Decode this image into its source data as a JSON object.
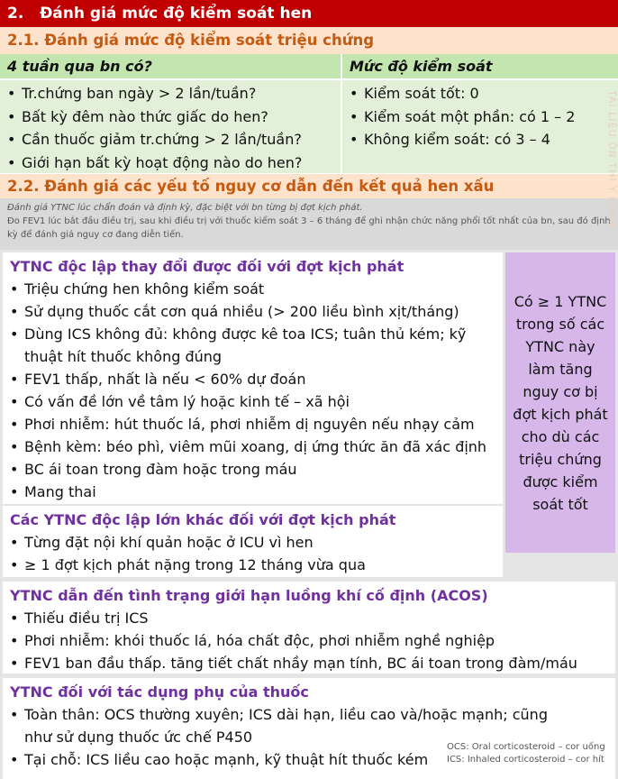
{
  "section": {
    "number": "2.",
    "title": "Đánh giá mức độ kiểm soát hen"
  },
  "symptom_control": {
    "heading": "2.1.  Đánh giá mức độ kiểm soát triệu chứng",
    "question_header": "4 tuần qua bn có?",
    "level_header": "Mức độ kiểm soát",
    "questions": [
      "Tr.chứng ban ngày > 2 lần/tuần?",
      "Bất kỳ đêm nào thức giấc do hen?",
      "Cần thuốc giảm tr.chứng > 2 lần/tuần?",
      "Giới hạn bất kỳ hoạt động nào do hen?"
    ],
    "levels": [
      "Kiểm soát tốt: 0",
      "Kiểm soát một phần: có 1 – 2",
      "Không kiểm soát: có 3 – 4"
    ]
  },
  "risk": {
    "heading": "2.2.  Đánh giá các yếu tố nguy cơ dẫn đến kết quả hen xấu",
    "note_1": "Đánh giá YTNC lúc chẩn đoán và định kỳ, đặc biệt với bn từng bị đợt kịch phát.",
    "note_2": "Đo FEV1 lúc bắt đầu điều trị, sau khi điều trị với thuốc kiểm soát 3 – 6 tháng để ghi nhận chức năng phổi tốt nhất của bn, sau đó định kỳ để đánh giá nguy cơ đang diễn tiến.",
    "modifiable": {
      "title": "YTNC độc lập thay đổi được đối với đợt kịch phát",
      "items": [
        "Triệu chứng hen không kiểm soát",
        "Sử dụng thuốc cắt cơn quá nhiều (> 200 liều bình xịt/tháng)",
        "Dùng ICS không đủ: không được kê toa ICS; tuân thủ kém; kỹ thuật hít thuốc không đúng",
        "FEV1 thấp, nhất là nếu < 60% dự đoán",
        "Có vấn đề lớn về tâm lý hoặc kinh tế – xã hội",
        "Phơi nhiễm: hút thuốc lá, phơi nhiễm dị nguyên nếu nhạy cảm",
        "Bệnh kèm: béo phì, viêm mũi xoang, dị ứng thức ăn đã xác định",
        "BC ái toan trong đàm hoặc trong máu",
        "Mang thai"
      ]
    },
    "major": {
      "title": "Các YTNC độc lập lớn khác đối với đợt kịch phát",
      "items": [
        "Từng đặt nội khí quản hoặc ở ICU vì hen",
        "≥ 1 đợt kịch phát nặng trong 12 tháng vừa qua"
      ]
    },
    "side_note": "Có ≥ 1 YTNC trong số các YTNC này làm tăng nguy cơ bị đợt kịch phát cho dù các triệu chứng được kiểm soát tốt",
    "acos": {
      "title": "YTNC dẫn đến tình trạng giới hạn luồng khí cố định (ACOS)",
      "items": [
        "Thiếu điều trị ICS",
        "Phơi nhiễm: khói thuốc lá, hóa chất độc, phơi nhiễm nghề nghiệp",
        "FEV1 ban đầu thấp. tăng tiết chất nhầy mạn tính, BC ái toan trong đàm/máu"
      ]
    },
    "side_effects": {
      "title": "YTNC đối với tác dụng phụ của thuốc",
      "items": [
        "Toàn thân: OCS thường xuyên; ICS dài hạn, liều cao và/hoặc mạnh; cũng như sử dụng thuốc ức chế P450",
        "Tại chỗ: ICS liều cao hoặc mạnh, kỹ thuật hít thuốc kém"
      ]
    },
    "footnotes": [
      "OCS: Oral corticosteroid – cor uống",
      "ICS: Inhaled corticosteroid – cor hít"
    ]
  },
  "watermark": "TÀI LIỆU ÔN THI Y KHOA",
  "colors": {
    "header_red": "#c00000",
    "subheader_bg": "#fde2cc",
    "subheader_text": "#c55a11",
    "green_header": "#c3e6b0",
    "green_body": "#e2f0d9",
    "purple_title": "#7030a0",
    "lavender": "#d7b7ea"
  }
}
